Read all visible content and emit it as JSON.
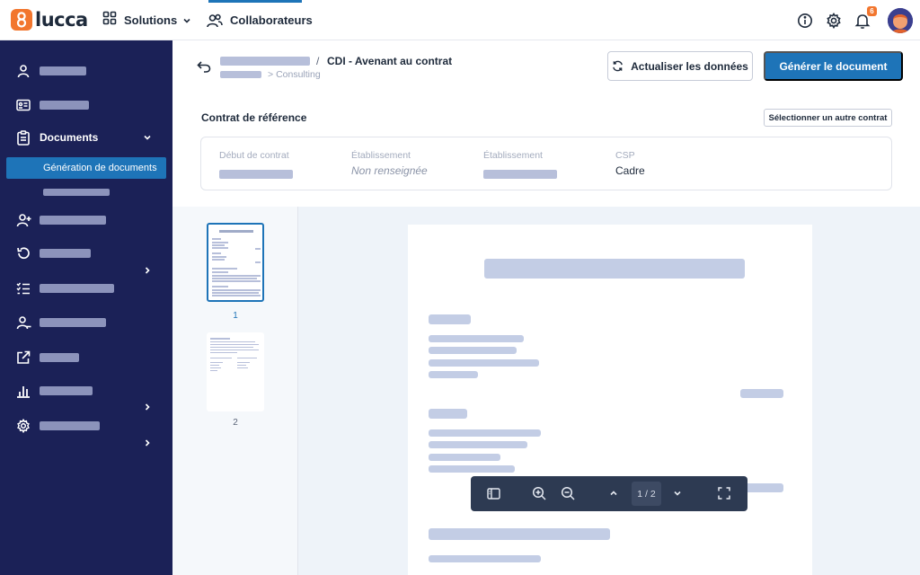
{
  "app": {
    "logo_text": "lucca",
    "brand_color": "#f2762e",
    "accent_color": "#1e74b8"
  },
  "topnav": {
    "solutions_label": "Solutions",
    "collaborateurs_label": "Collaborateurs",
    "notification_count": "6"
  },
  "sidebar": {
    "documents_label": "Documents",
    "active_sub_label": "Génération de documents"
  },
  "header": {
    "breadcrumb_separator": "/",
    "title": "CDI - Avenant au contrat",
    "sub_separator": ">",
    "sub_path": "Consulting",
    "refresh_button": "Actualiser les données",
    "generate_button": "Générer le document"
  },
  "reference": {
    "section_title": "Contrat de référence",
    "select_button": "Sélectionner un autre contrat",
    "fields": [
      {
        "label": "Début de contrat",
        "value": ""
      },
      {
        "label": "Établissement",
        "value": "Non renseignée"
      },
      {
        "label": "Établissement",
        "value": ""
      },
      {
        "label": "CSP",
        "value": "Cadre"
      }
    ]
  },
  "viewer": {
    "thumbnails": [
      {
        "number": "1"
      },
      {
        "number": "2"
      }
    ],
    "page_indicator": "1 / 2"
  }
}
